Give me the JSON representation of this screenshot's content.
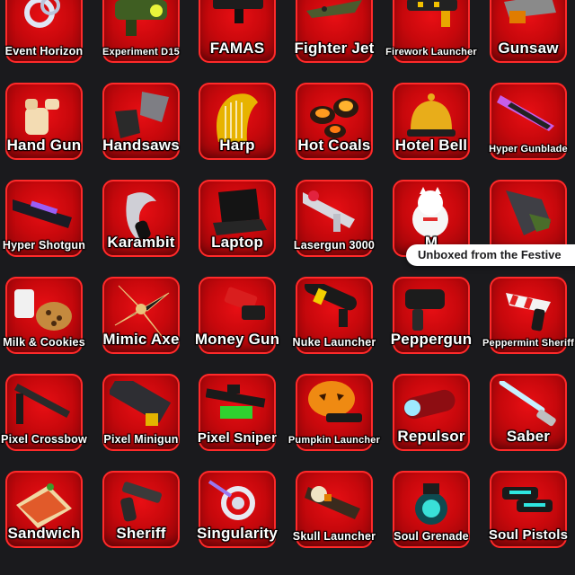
{
  "tiles": [
    {
      "label": "Event Horizon",
      "icon": "event-horizon-icon",
      "size": "s"
    },
    {
      "label": "Experiment D15",
      "icon": "experiment-d15-icon",
      "size": "xs"
    },
    {
      "label": "FAMAS",
      "icon": "famas-icon",
      "size": "l"
    },
    {
      "label": "Fighter Jet",
      "icon": "fighter-jet-icon",
      "size": "l"
    },
    {
      "label": "Firework Launcher",
      "icon": "firework-launcher-icon",
      "size": "xs"
    },
    {
      "label": "Gunsaw",
      "icon": "gunsaw-icon",
      "size": "l"
    },
    {
      "label": "Hand Gun",
      "icon": "hand-gun-icon",
      "size": "l"
    },
    {
      "label": "Handsaws",
      "icon": "handsaws-icon",
      "size": "l"
    },
    {
      "label": "Harp",
      "icon": "harp-icon",
      "size": "l"
    },
    {
      "label": "Hot Coals",
      "icon": "hot-coals-icon",
      "size": "l"
    },
    {
      "label": "Hotel Bell",
      "icon": "hotel-bell-icon",
      "size": "l"
    },
    {
      "label": "Hyper Gunblade",
      "icon": "hyper-gunblade-icon",
      "size": "xs"
    },
    {
      "label": "Hyper Shotgun",
      "icon": "hyper-shotgun-icon",
      "size": "s"
    },
    {
      "label": "Karambit",
      "icon": "karambit-icon",
      "size": "l"
    },
    {
      "label": "Laptop",
      "icon": "laptop-icon",
      "size": "l"
    },
    {
      "label": "Lasergun 3000",
      "icon": "lasergun-3000-icon",
      "size": "s"
    },
    {
      "label": "M",
      "icon": "maneki-neko-icon",
      "size": "l"
    },
    {
      "label": "",
      "icon": "drill-icon",
      "size": "l"
    },
    {
      "label": "Milk & Cookies",
      "icon": "milk-cookies-icon",
      "size": "s"
    },
    {
      "label": "Mimic Axe",
      "icon": "mimic-axe-icon",
      "size": "l"
    },
    {
      "label": "Money Gun",
      "icon": "money-gun-icon",
      "size": "l"
    },
    {
      "label": "Nuke Launcher",
      "icon": "nuke-launcher-icon",
      "size": "s"
    },
    {
      "label": "Peppergun",
      "icon": "peppergun-icon",
      "size": "l"
    },
    {
      "label": "Peppermint Sheriff",
      "icon": "peppermint-sheriff-icon",
      "size": "xs"
    },
    {
      "label": "Pixel Crossbow",
      "icon": "pixel-crossbow-icon",
      "size": "s"
    },
    {
      "label": "Pixel Minigun",
      "icon": "pixel-minigun-icon",
      "size": "s"
    },
    {
      "label": "Pixel Sniper",
      "icon": "pixel-sniper-icon",
      "size": "m"
    },
    {
      "label": "Pumpkin Launcher",
      "icon": "pumpkin-launcher-icon",
      "size": "xs"
    },
    {
      "label": "Repulsor",
      "icon": "repulsor-icon",
      "size": "l"
    },
    {
      "label": "Saber",
      "icon": "saber-icon",
      "size": "l"
    },
    {
      "label": "Sandwich",
      "icon": "sandwich-icon",
      "size": "l"
    },
    {
      "label": "Sheriff",
      "icon": "sheriff-icon",
      "size": "l"
    },
    {
      "label": "Singularity",
      "icon": "singularity-icon",
      "size": "l"
    },
    {
      "label": "Skull Launcher",
      "icon": "skull-launcher-icon",
      "size": "s"
    },
    {
      "label": "Soul Grenade",
      "icon": "soul-grenade-icon",
      "size": "s"
    },
    {
      "label": "Soul Pistols",
      "icon": "soul-pistols-icon",
      "size": "m"
    }
  ],
  "tooltip": {
    "text": "Unboxed from the Festive"
  },
  "colors": {
    "tile": "#d00a0e",
    "tile_border": "#ff2a2a",
    "background": "#1a1a1d"
  }
}
